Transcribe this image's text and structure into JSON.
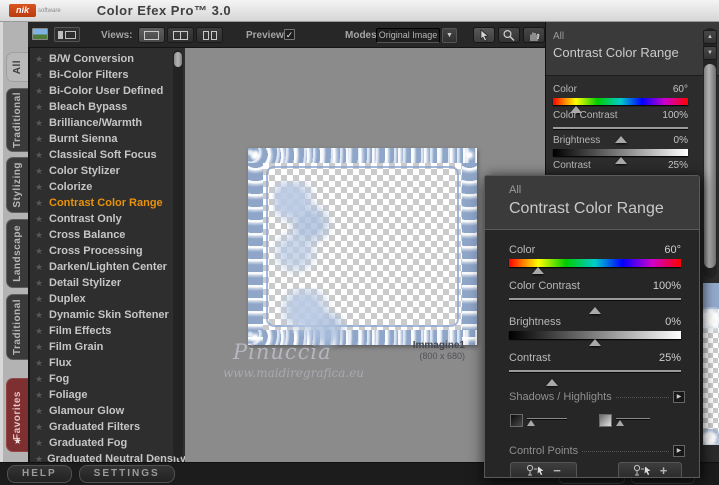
{
  "window": {
    "logo": "nik",
    "logo_sub": "software",
    "title": "Color Efex Pro™ 3.0"
  },
  "toolbar": {
    "views_label": "Views:",
    "preview_label": "Preview:",
    "modes_label": "Modes:",
    "modes_value": "Original Image"
  },
  "tabs": [
    "All",
    "Traditional",
    "Stylizing",
    "Landscape",
    "Traditional",
    "Favorites"
  ],
  "filters": [
    {
      "label": "B/W Conversion"
    },
    {
      "label": "Bi-Color Filters"
    },
    {
      "label": "Bi-Color User Defined"
    },
    {
      "label": "Bleach Bypass"
    },
    {
      "label": "Brilliance/Warmth"
    },
    {
      "label": "Burnt Sienna"
    },
    {
      "label": "Classical Soft Focus"
    },
    {
      "label": "Color Stylizer"
    },
    {
      "label": "Colorize"
    },
    {
      "label": "Contrast Color Range",
      "selected": true
    },
    {
      "label": "Contrast Only"
    },
    {
      "label": "Cross Balance"
    },
    {
      "label": "Cross Processing"
    },
    {
      "label": "Darken/Lighten Center"
    },
    {
      "label": "Detail Stylizer"
    },
    {
      "label": "Duplex"
    },
    {
      "label": "Dynamic Skin Softener"
    },
    {
      "label": "Film Effects"
    },
    {
      "label": "Film Grain"
    },
    {
      "label": "Flux"
    },
    {
      "label": "Fog"
    },
    {
      "label": "Foliage"
    },
    {
      "label": "Glamour Glow"
    },
    {
      "label": "Graduated Filters"
    },
    {
      "label": "Graduated Fog"
    },
    {
      "label": "Graduated Neutral Density"
    }
  ],
  "footer": {
    "help": "HELP",
    "settings": "SETTINGS"
  },
  "panel": {
    "category": "All",
    "title": "Contrast Color Range",
    "sliders": [
      {
        "label": "Color",
        "value": "60°",
        "pos": 16.7
      },
      {
        "label": "Color Contrast",
        "value": "100%",
        "pos": 50
      },
      {
        "label": "Brightness",
        "value": "0%",
        "pos": 50
      },
      {
        "label": "Contrast",
        "value": "25%",
        "pos": 25
      }
    ],
    "sections": {
      "shadows_highlights": "Shadows / Highlights",
      "control_points": "Control Points"
    },
    "buttons": {
      "minus": "−",
      "plus": "+"
    }
  },
  "preview": {
    "image_name": "Immagine1",
    "image_size": "(800 x 680)",
    "watermark": "Pinuccia",
    "watermark_url": "www.maidiregrafica.eu"
  },
  "icons": {
    "star": "★",
    "check": "✓",
    "dropdown_arrow": "▼",
    "scroll_up": "▲",
    "scroll_down": "▼",
    "expand": "▶"
  },
  "colors": {
    "accent_selected": "#E8920A",
    "favorites_tab": "#7E3030",
    "frame_blue": "#8FA6C8",
    "logo_red": "#C8441A"
  }
}
